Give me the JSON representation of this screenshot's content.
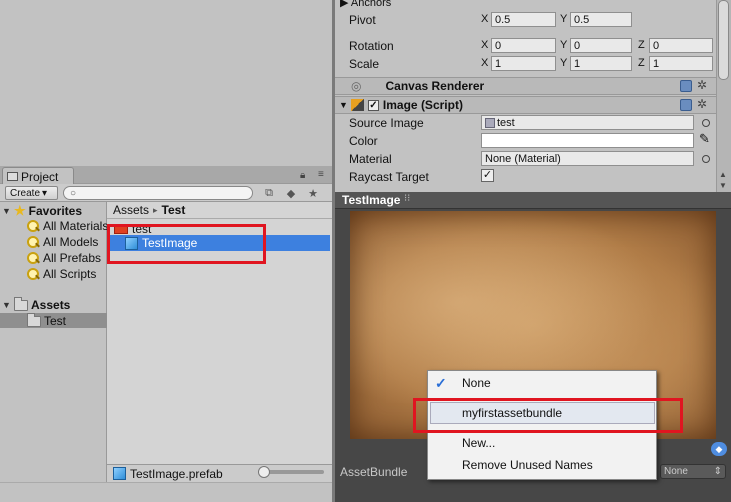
{
  "colors": {
    "selection": "#3d80df",
    "highlight": "#e01520",
    "check": "#2a6ed6"
  },
  "project": {
    "tab_label": "Project",
    "create_label": "Create",
    "favorites": {
      "title": "Favorites",
      "items": [
        "All Materials",
        "All Models",
        "All Prefabs",
        "All Scripts"
      ]
    },
    "assets": {
      "title": "Assets",
      "child": "Test"
    },
    "breadcrumb": {
      "root": "Assets",
      "sep": "▸",
      "current": "Test"
    },
    "files": [
      {
        "name": "test",
        "icon": "texture-icon"
      },
      {
        "name": "TestImage",
        "icon": "prefab-cube-icon"
      }
    ],
    "status_file": "TestImage.prefab"
  },
  "inspector": {
    "anchors_label": "Anchors",
    "pivot": {
      "label": "Pivot",
      "x": "0.5",
      "y": "0.5"
    },
    "rotation": {
      "label": "Rotation",
      "x": "0",
      "y": "0",
      "z": "0"
    },
    "scale": {
      "label": "Scale",
      "x": "1",
      "y": "1",
      "z": "1"
    },
    "canvas_renderer": "Canvas Renderer",
    "image_script": "Image (Script)",
    "source_image": {
      "label": "Source Image",
      "value": "test"
    },
    "color": {
      "label": "Color"
    },
    "material": {
      "label": "Material",
      "value": "None (Material)"
    },
    "raycast": {
      "label": "Raycast Target",
      "checked": true
    },
    "axes": {
      "x": "X",
      "y": "Y",
      "z": "Z"
    }
  },
  "preview": {
    "title": "TestImage",
    "assetbundle_label": "AssetBundle",
    "none_value": "None"
  },
  "menu": {
    "items": [
      "None",
      "myfirstassetbundle",
      "New...",
      "Remove Unused Names"
    ],
    "selected": "None"
  }
}
